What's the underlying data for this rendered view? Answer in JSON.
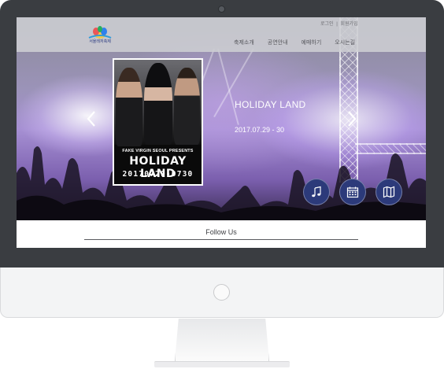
{
  "header": {
    "logo_text": "서울레저축제",
    "util_links": [
      "로그인",
      "회원가입"
    ],
    "util_separator": "|",
    "nav": [
      "축제소개",
      "공연안내",
      "예매하기",
      "오시는길"
    ]
  },
  "slide": {
    "title": "HOLIDAY LAND",
    "date": "2017.07.29 - 30"
  },
  "poster": {
    "presents": "FAKE VIRGIN SEOUL PRESENTS",
    "title": "HOLIDAY LAND",
    "date": "20170729-0730"
  },
  "quick_links": {
    "icons": [
      "music-note-icon",
      "calendar-icon",
      "map-icon"
    ]
  },
  "footer": {
    "follow": "Follow Us"
  },
  "colors": {
    "bezel": "#3a3d41",
    "circle_button": "#2c3a7a",
    "header_bg": "#cdced3"
  }
}
